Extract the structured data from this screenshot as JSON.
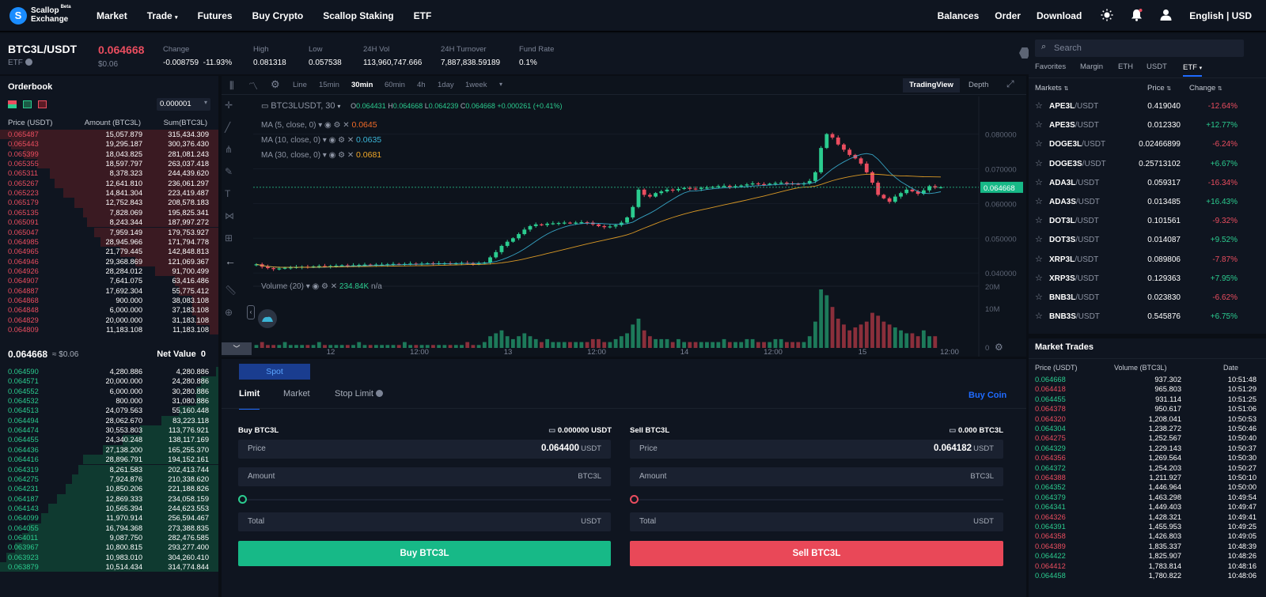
{
  "nav": {
    "logo_line1": "Scallop",
    "logo_line2": "Exchange",
    "logo_beta": "Beta",
    "links": [
      "Market",
      "Trade",
      "Futures",
      "Buy Crypto",
      "Scallop Staking",
      "ETF"
    ],
    "right_links": [
      "Balances",
      "Order",
      "Download"
    ],
    "language": "English | USD"
  },
  "ticker": {
    "symbol": "BTC3L/USDT",
    "symbol_sub": "ETF",
    "last_price": "0.064668",
    "last_usd": "$0.06",
    "stats": [
      {
        "label": "Change",
        "value": "-0.008759",
        "value2": "-11.93%"
      },
      {
        "label": "High",
        "value": "0.081318"
      },
      {
        "label": "Low",
        "value": "0.057538"
      },
      {
        "label": "24H Vol",
        "value": "113,960,747.666"
      },
      {
        "label": "24H Turnover",
        "value": "7,887,838.59189"
      },
      {
        "label": "Fund Rate",
        "value": "0.1%"
      }
    ]
  },
  "orderbook": {
    "title": "Orderbook",
    "precision": "0.000001",
    "headers": [
      "Price (USDT)",
      "Amount (BTC3L)",
      "Sum(BTC3L)"
    ],
    "asks": [
      [
        "0.065487",
        "15,057.879",
        "315,434.309"
      ],
      [
        "0.065443",
        "19,295.187",
        "300,376.430"
      ],
      [
        "0.065399",
        "18,043.825",
        "281,081.243"
      ],
      [
        "0.065355",
        "18,597.797",
        "263,037.418"
      ],
      [
        "0.065311",
        "8,378.323",
        "244,439.620"
      ],
      [
        "0.065267",
        "12,641.810",
        "236,061.297"
      ],
      [
        "0.065223",
        "14,841.304",
        "223,419.487"
      ],
      [
        "0.065179",
        "12,752.843",
        "208,578.183"
      ],
      [
        "0.065135",
        "7,828.069",
        "195,825.341"
      ],
      [
        "0.065091",
        "8,243.344",
        "187,997.272"
      ],
      [
        "0.065047",
        "7,959.149",
        "179,753.927"
      ],
      [
        "0.064985",
        "28,945.966",
        "171,794.778"
      ],
      [
        "0.064965",
        "21,779.445",
        "142,848.813"
      ],
      [
        "0.064946",
        "29,368.869",
        "121,069.367"
      ],
      [
        "0.064926",
        "28,284.012",
        "91,700.499"
      ],
      [
        "0.064907",
        "7,641.075",
        "63,416.486"
      ],
      [
        "0.064887",
        "17,692.304",
        "55,775.412"
      ],
      [
        "0.064868",
        "900.000",
        "38,083.108"
      ],
      [
        "0.064848",
        "6,000.000",
        "37,183.108"
      ],
      [
        "0.064829",
        "20,000.000",
        "31,183.108"
      ],
      [
        "0.064809",
        "11,183.108",
        "11,183.108"
      ]
    ],
    "ask_depth": [
      1.0,
      0.95,
      0.89,
      0.83,
      0.77,
      0.75,
      0.71,
      0.66,
      0.62,
      0.6,
      0.57,
      0.54,
      0.45,
      0.38,
      0.29,
      0.2,
      0.18,
      0.12,
      0.12,
      0.1,
      0.04
    ],
    "mid_price": "0.064668",
    "mid_usd": "≈ $0.06",
    "net_value_label": "Net Value",
    "net_value": "0",
    "bids": [
      [
        "0.064590",
        "4,280.886",
        "4,280.886"
      ],
      [
        "0.064571",
        "20,000.000",
        "24,280.886"
      ],
      [
        "0.064552",
        "6,000.000",
        "30,280.886"
      ],
      [
        "0.064532",
        "800.000",
        "31,080.886"
      ],
      [
        "0.064513",
        "24,079.563",
        "55,160.448"
      ],
      [
        "0.064494",
        "28,062.670",
        "83,223.118"
      ],
      [
        "0.064474",
        "30,553.803",
        "113,776.921"
      ],
      [
        "0.064455",
        "24,340.248",
        "138,117.169"
      ],
      [
        "0.064436",
        "27,138.200",
        "165,255.370"
      ],
      [
        "0.064416",
        "28,896.791",
        "194,152.161"
      ],
      [
        "0.064319",
        "8,261.583",
        "202,413.744"
      ],
      [
        "0.064275",
        "7,924.876",
        "210,338.620"
      ],
      [
        "0.064231",
        "10,850.206",
        "221,188.826"
      ],
      [
        "0.064187",
        "12,869.333",
        "234,058.159"
      ],
      [
        "0.064143",
        "10,565.394",
        "244,623.553"
      ],
      [
        "0.064099",
        "11,970.914",
        "256,594.467"
      ],
      [
        "0.064055",
        "16,794.368",
        "273,388.835"
      ],
      [
        "0.064011",
        "9,087.750",
        "282,476.585"
      ],
      [
        "0.063967",
        "10,800.815",
        "293,277.400"
      ],
      [
        "0.063923",
        "10,983.010",
        "304,260.410"
      ],
      [
        "0.063879",
        "10,514.434",
        "314,774.844"
      ]
    ],
    "bid_depth": [
      0.01,
      0.08,
      0.1,
      0.1,
      0.18,
      0.26,
      0.36,
      0.44,
      0.53,
      0.62,
      0.64,
      0.67,
      0.7,
      0.74,
      0.78,
      0.81,
      0.87,
      0.9,
      0.93,
      0.97,
      1.0
    ]
  },
  "chart": {
    "toolbar": [
      "Line",
      "15min",
      "30min",
      "60min",
      "4h",
      "1day",
      "1week"
    ],
    "active_tf": "30min",
    "tv_tab": "TradingView",
    "depth_tab": "Depth",
    "legend_symbol": "BTC3LUSDT, 30",
    "ohlc": {
      "o_label": "O",
      "o": "0.064431",
      "h_label": "H",
      "h": "0.064668",
      "l_label": "L",
      "l": "0.064239",
      "c_label": "C",
      "c": "0.064668",
      "chg": "+0.000261 (+0.41%)"
    },
    "ma": [
      {
        "label": "MA (5, close, 0)",
        "value": "0.0645",
        "color": "#f06a27"
      },
      {
        "label": "MA (10, close, 0)",
        "value": "0.0635",
        "color": "#3bb4d6"
      },
      {
        "label": "MA (30, close, 0)",
        "value": "0.0681",
        "color": "#f0a727"
      }
    ],
    "volume_label": "Volume (20)",
    "volume_value": "234.84K",
    "volume_na": "n/a",
    "price_axis": [
      "0.080000",
      "0.070000",
      "0.060000",
      "0.050000",
      "0.040000"
    ],
    "current_price": "0.064668",
    "vol_axis": [
      "20M",
      "10M",
      "0"
    ],
    "time_axis": [
      "12",
      "12:00",
      "13",
      "12:00",
      "14",
      "12:00",
      "15",
      "12:00"
    ],
    "colors": {
      "up": "#2bcc8f",
      "down": "#ea4d5f"
    }
  },
  "chart_data": {
    "type": "candlestick",
    "close_series": [
      0.0425,
      0.0418,
      0.0414,
      0.0412,
      0.0413,
      0.0415,
      0.0416,
      0.0417,
      0.0418,
      0.0417,
      0.0419,
      0.042,
      0.0419,
      0.042,
      0.0421,
      0.0422,
      0.0421,
      0.0422,
      0.0423,
      0.0424,
      0.0423,
      0.0424,
      0.0424,
      0.0425,
      0.0426,
      0.0425,
      0.0426,
      0.0427,
      0.0426,
      0.0427,
      0.0428,
      0.0427,
      0.0428,
      0.0428,
      0.0427,
      0.0428,
      0.0429,
      0.0428,
      0.0427,
      0.0428,
      0.043,
      0.0445,
      0.046,
      0.0478,
      0.049,
      0.05,
      0.0512,
      0.0525,
      0.0535,
      0.054,
      0.0538,
      0.0542,
      0.0543,
      0.0544,
      0.0545,
      0.0544,
      0.0545,
      0.0546,
      0.0545,
      0.054,
      0.0535,
      0.0532,
      0.0534,
      0.0538,
      0.0545,
      0.056,
      0.059,
      0.064,
      0.0625,
      0.062,
      0.063,
      0.0635,
      0.064,
      0.0638,
      0.0642,
      0.0645,
      0.0643,
      0.0642,
      0.0645,
      0.0646,
      0.0648,
      0.065,
      0.0651,
      0.0648,
      0.065,
      0.0652,
      0.0655,
      0.0658,
      0.0656,
      0.0655,
      0.0657,
      0.0659,
      0.066,
      0.0658,
      0.0657,
      0.0656,
      0.0658,
      0.0665,
      0.069,
      0.076,
      0.08,
      0.079,
      0.077,
      0.0755,
      0.074,
      0.073,
      0.0715,
      0.069,
      0.066,
      0.0625,
      0.0615,
      0.0605,
      0.062,
      0.063,
      0.064,
      0.0635,
      0.0628,
      0.0638,
      0.065,
      0.0646,
      0.0647
    ],
    "volume_series": [
      1,
      2,
      1,
      1,
      1,
      2,
      1,
      1,
      1,
      1,
      1,
      2,
      1,
      1,
      1,
      1,
      1,
      1,
      2,
      1,
      1,
      1,
      1,
      1,
      1,
      1,
      2,
      1,
      1,
      1,
      1,
      1,
      1,
      1,
      1,
      1,
      1,
      2,
      1,
      1,
      2,
      4,
      5,
      6,
      4,
      3,
      4,
      5,
      4,
      3,
      2,
      3,
      2,
      2,
      2,
      2,
      2,
      2,
      2,
      3,
      3,
      2,
      2,
      3,
      4,
      5,
      8,
      10,
      6,
      4,
      3,
      3,
      3,
      2,
      3,
      2,
      2,
      2,
      2,
      2,
      2,
      2,
      3,
      2,
      2,
      2,
      3,
      3,
      2,
      2,
      2,
      3,
      3,
      2,
      2,
      2,
      2,
      4,
      9,
      20,
      18,
      14,
      10,
      8,
      6,
      7,
      8,
      9,
      12,
      11,
      9,
      8,
      7,
      6,
      5,
      5,
      4,
      6,
      4,
      4
    ],
    "ylim": [
      0.038,
      0.084
    ]
  },
  "form": {
    "spot_tab": "Spot",
    "order_tabs": [
      "Limit",
      "Market",
      "Stop Limit"
    ],
    "buy_coin": "Buy Coin",
    "buy": {
      "title": "Buy BTC3L",
      "balance": "0.000000 USDT",
      "price_label": "Price",
      "price": "0.064400",
      "price_unit": "USDT",
      "amount_label": "Amount",
      "amount_unit": "BTC3L",
      "total_label": "Total",
      "total_unit": "USDT",
      "button": "Buy BTC3L"
    },
    "sell": {
      "title": "Sell BTC3L",
      "balance": "0.000 BTC3L",
      "price_label": "Price",
      "price": "0.064182",
      "price_unit": "USDT",
      "amount_label": "Amount",
      "amount_unit": "BTC3L",
      "total_label": "Total",
      "total_unit": "USDT",
      "button": "Sell BTC3L"
    }
  },
  "markets": {
    "search_placeholder": "Search",
    "tabs": [
      "Favorites",
      "Margin",
      "ETH",
      "USDT",
      "ETF"
    ],
    "active_tab": "ETF",
    "headers": [
      "Markets",
      "Price",
      "Change"
    ],
    "quote": "/USDT",
    "rows": [
      {
        "name": "APE3L",
        "price": "0.419040",
        "change": "-12.64%",
        "up": false
      },
      {
        "name": "APE3S",
        "price": "0.012330",
        "change": "+12.77%",
        "up": true
      },
      {
        "name": "DOGE3L",
        "price": "0.02466899",
        "change": "-6.24%",
        "up": false
      },
      {
        "name": "DOGE3S",
        "price": "0.25713102",
        "change": "+6.67%",
        "up": true
      },
      {
        "name": "ADA3L",
        "price": "0.059317",
        "change": "-16.34%",
        "up": false
      },
      {
        "name": "ADA3S",
        "price": "0.013485",
        "change": "+16.43%",
        "up": true
      },
      {
        "name": "DOT3L",
        "price": "0.101561",
        "change": "-9.32%",
        "up": false
      },
      {
        "name": "DOT3S",
        "price": "0.014087",
        "change": "+9.52%",
        "up": true
      },
      {
        "name": "XRP3L",
        "price": "0.089806",
        "change": "-7.87%",
        "up": false
      },
      {
        "name": "XRP3S",
        "price": "0.129363",
        "change": "+7.95%",
        "up": true
      },
      {
        "name": "BNB3L",
        "price": "0.023830",
        "change": "-6.62%",
        "up": false
      },
      {
        "name": "BNB3S",
        "price": "0.545876",
        "change": "+6.75%",
        "up": true
      }
    ]
  },
  "trades": {
    "title": "Market Trades",
    "headers": [
      "Price (USDT)",
      "Volume (BTC3L)",
      "Date"
    ],
    "rows": [
      [
        "0.064668",
        "937.302",
        "10:51:48",
        true
      ],
      [
        "0.064418",
        "965.803",
        "10:51:29",
        false
      ],
      [
        "0.064455",
        "931.114",
        "10:51:25",
        true
      ],
      [
        "0.064378",
        "950.617",
        "10:51:06",
        false
      ],
      [
        "0.064320",
        "1,208.041",
        "10:50:53",
        false
      ],
      [
        "0.064304",
        "1,238.272",
        "10:50:46",
        true
      ],
      [
        "0.064275",
        "1,252.567",
        "10:50:40",
        false
      ],
      [
        "0.064329",
        "1,229.143",
        "10:50:37",
        true
      ],
      [
        "0.064356",
        "1,269.564",
        "10:50:30",
        false
      ],
      [
        "0.064372",
        "1,254.203",
        "10:50:27",
        true
      ],
      [
        "0.064388",
        "1,211.927",
        "10:50:10",
        false
      ],
      [
        "0.064352",
        "1,446.964",
        "10:50:00",
        true
      ],
      [
        "0.064379",
        "1,463.298",
        "10:49:54",
        true
      ],
      [
        "0.064341",
        "1,449.403",
        "10:49:47",
        true
      ],
      [
        "0.064326",
        "1,428.321",
        "10:49:41",
        false
      ],
      [
        "0.064391",
        "1,455.953",
        "10:49:25",
        true
      ],
      [
        "0.064358",
        "1,426.803",
        "10:49:05",
        false
      ],
      [
        "0.064389",
        "1,835.337",
        "10:48:39",
        false
      ],
      [
        "0.064422",
        "1,825.907",
        "10:48:26",
        true
      ],
      [
        "0.064412",
        "1,783.814",
        "10:48:16",
        false
      ],
      [
        "0.064458",
        "1,780.822",
        "10:48:06",
        true
      ]
    ]
  }
}
